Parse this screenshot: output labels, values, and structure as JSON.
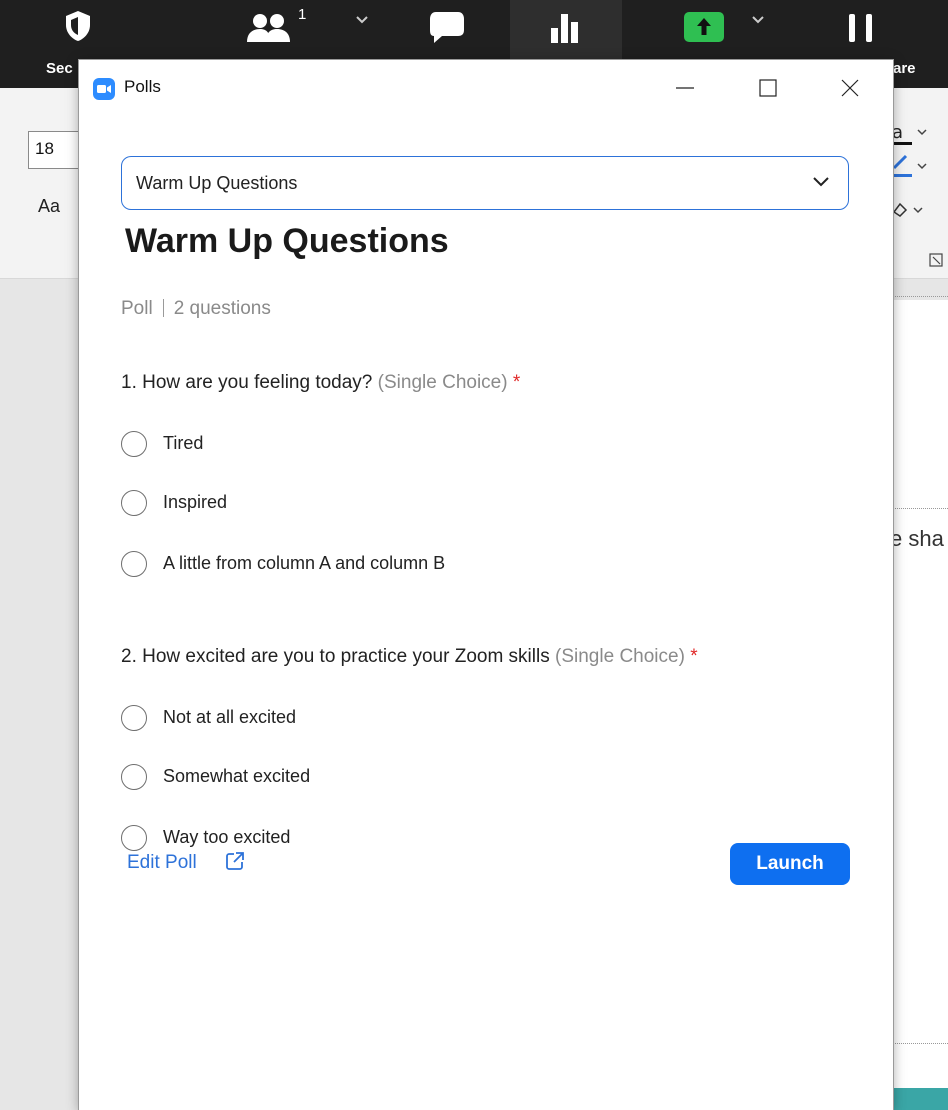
{
  "background": {
    "toolbar": {
      "security_label": "Sec",
      "participants_count": "1",
      "share_label": "are"
    },
    "ribbon": {
      "font_size_value": "18",
      "font_case_label": "Aa"
    },
    "document_text": "e sha"
  },
  "window": {
    "title": "Polls",
    "minimize_icon": "minimize-icon",
    "maximize_icon": "maximize-icon",
    "close_icon": "close-icon"
  },
  "poll_select": {
    "value": "Warm Up Questions",
    "icon": "chevron-down-icon"
  },
  "poll": {
    "title": "Warm Up Questions",
    "type": "Poll",
    "question_count": "2 questions",
    "questions": [
      {
        "text": "1. How are you feeling today?",
        "type": "(Single Choice)",
        "required": "*",
        "options": [
          "Tired",
          "Inspired",
          "A little from column A and column B"
        ]
      },
      {
        "text": "2. How excited are you to practice your Zoom skills",
        "type": "(Single Choice)",
        "required": "*",
        "options": [
          "Not at all excited",
          "Somewhat excited",
          "Way too excited"
        ]
      }
    ]
  },
  "footer": {
    "edit_label": "Edit Poll",
    "edit_icon": "external-link-icon",
    "launch_label": "Launch"
  },
  "colors": {
    "accent": "#2d72d9",
    "launch": "#0e6ff0",
    "required": "#e02828",
    "share_green": "#2fbf52"
  }
}
